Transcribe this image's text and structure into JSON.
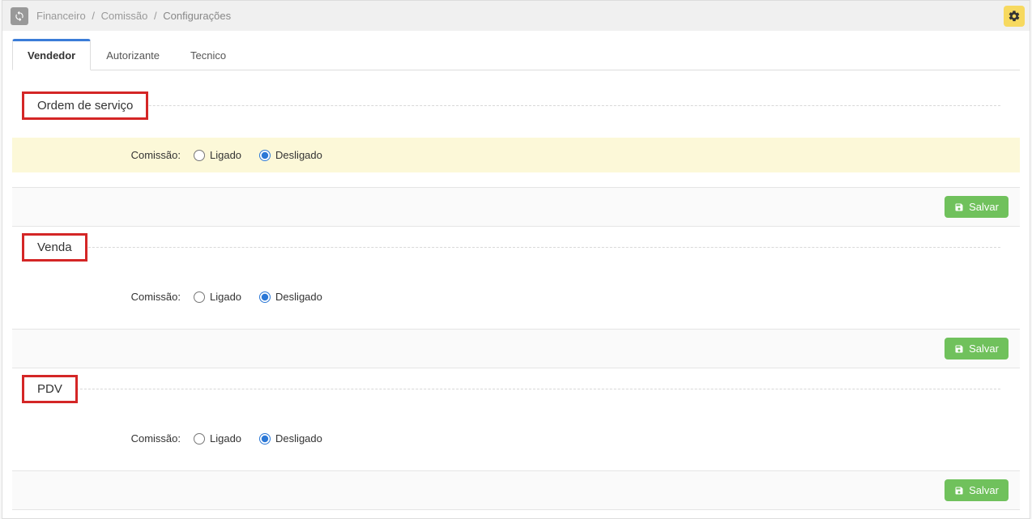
{
  "breadcrumb": {
    "level1": "Financeiro",
    "level2": "Comissão",
    "current": "Configurações"
  },
  "tabs": {
    "vendedor": "Vendedor",
    "autorizante": "Autorizante",
    "tecnico": "Tecnico"
  },
  "labels": {
    "comissao": "Comissão:",
    "ligado": "Ligado",
    "desligado": "Desligado",
    "salvar": "Salvar"
  },
  "sections": {
    "ordem": {
      "title": "Ordem de serviço",
      "selected": "desligado"
    },
    "venda": {
      "title": "Venda",
      "selected": "desligado"
    },
    "pdv": {
      "title": "PDV",
      "selected": "desligado"
    }
  }
}
